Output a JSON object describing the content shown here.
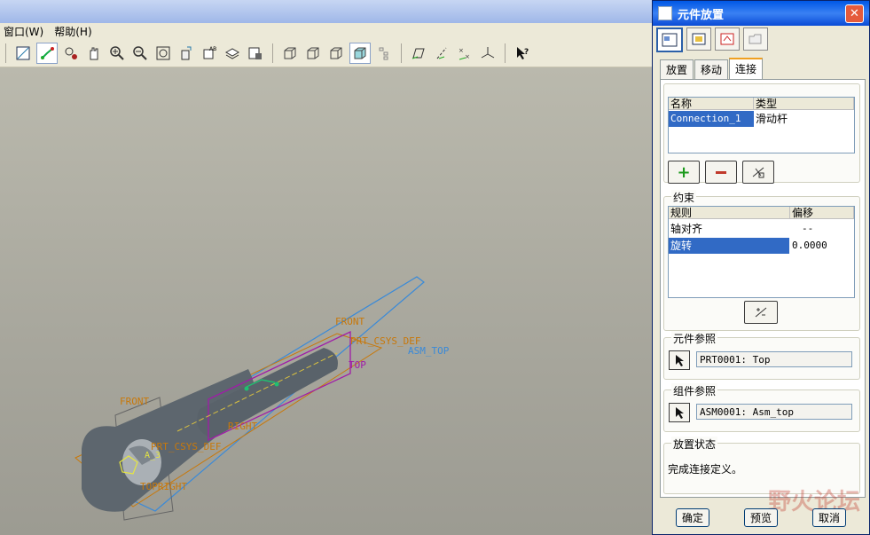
{
  "menu": {
    "items": [
      "窗口(W)",
      "帮助(H)"
    ]
  },
  "dialog": {
    "title": "元件放置",
    "tabs": [
      "放置",
      "移动",
      "连接"
    ],
    "selected_tab": "连接",
    "connections_table": {
      "headers": [
        "名称",
        "类型"
      ],
      "rows": [
        {
          "name": "Connection_1",
          "type": "滑动杆"
        }
      ]
    },
    "constraints": {
      "label": "约束",
      "headers": [
        "规则",
        "偏移"
      ],
      "rows": [
        {
          "rule": "轴对齐",
          "offset": "--"
        },
        {
          "rule": "旋转",
          "offset": "0.0000"
        }
      ]
    },
    "component_ref": {
      "label": "元件参照",
      "value": "PRT0001: Top"
    },
    "assembly_ref": {
      "label": "组件参照",
      "value": "ASM0001: Asm_top"
    },
    "status": {
      "label": "放置状态",
      "text": "完成连接定义。"
    },
    "buttons": {
      "ok": "确定",
      "preview": "预览",
      "cancel": "取消"
    }
  },
  "model_labels": {
    "front_top": "FRONT",
    "prt_csys_top": "PRT_CSYS_DEF",
    "asm_top": "ASM_TOP",
    "top": "TOP",
    "front_left": "FRONT",
    "right": "RIGHT",
    "prt_csys_bottom": "PRT_CSYS_DEF",
    "topright": "TOPRIGHT",
    "a3": "A_3"
  },
  "watermark": "野火论坛",
  "colors": {
    "accent": "#316ac5",
    "plane_orange": "#c8780a",
    "plane_blue": "#3a8ad8",
    "plane_magenta": "#a01ca8"
  }
}
